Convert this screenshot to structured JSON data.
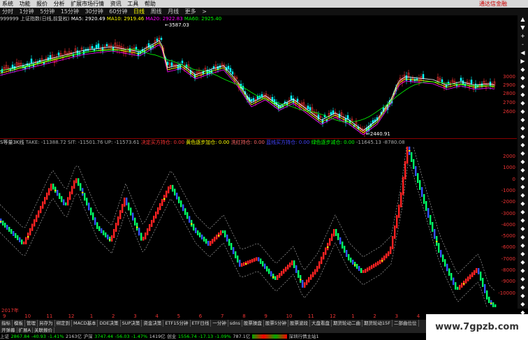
{
  "menu": {
    "items": [
      "系统",
      "功能",
      "报价",
      "分析",
      "扩展市场行情",
      "资讯",
      "工具",
      "帮助"
    ],
    "promo": "通达信金融"
  },
  "timeframes": {
    "items": [
      "分时",
      "1分钟",
      "5分钟",
      "15分钟",
      "30分钟",
      "60分钟",
      "日线",
      "周线",
      "月线",
      "更多"
    ],
    "active_index": 6,
    "arrow": ">"
  },
  "main_info": {
    "symbol": "999999 上证指数(日线,前复权)",
    "ma5": "MA5: 2920.49",
    "ma10": "MA10: 2919.46",
    "ma20": "MA20: 2922.83",
    "ma60": "MA60: 2925.40",
    "colors": {
      "ma5": "#ffffff",
      "ma10": "#ffff00",
      "ma20": "#ff00ff",
      "ma60": "#00ff00"
    }
  },
  "annotations": {
    "high": "3587.03",
    "low": "2440.91"
  },
  "main_axis": [
    "3000",
    "2900",
    "2800",
    "2700",
    "2600"
  ],
  "indicator_info": {
    "title": "S等量3K线",
    "take": "TAKE: -11388.72",
    "sit": "SIT: -11501.76",
    "up": "UP: -11573.61",
    "l1_label": "决定买方持仓: ",
    "l1_value": "0.00",
    "l2_label": "黄色逐步加仓: ",
    "l2_value": "0.00",
    "l3_label": "洗红持仓: ",
    "l3_value": "0.00",
    "l4_label": "蓝线买方持仓: ",
    "l4_value": "0.00",
    "l5_label": "绿色逐步减仓: ",
    "l5_value": "0.00",
    "v6": "-11645.13",
    "v7": "-8780.08"
  },
  "ind_axis": [
    "2000",
    "1000",
    "0",
    "-1000",
    "-2000",
    "-3000",
    "-4000",
    "-5000",
    "-6000",
    "-7000",
    "-8000",
    "-9000",
    "-10000"
  ],
  "date_axis": {
    "year_label": "2017年",
    "ticks": [
      "9",
      "10",
      "11",
      "12",
      "1",
      "2",
      "3",
      "4",
      "5",
      "6",
      "7",
      "8",
      "9",
      "10",
      "11",
      "12",
      "1",
      "2",
      "3",
      "4"
    ]
  },
  "tabs_row1": [
    "指标",
    "模板",
    "管理",
    "另存为",
    "绑定到",
    "MACD基本",
    "DDE决策",
    "SUP决策",
    "资金决策",
    "ETF15分钟",
    "ETF日线",
    "一分钟",
    "sdns",
    "股票操盘",
    "股票5分钟",
    "股票波段",
    "大盘看盘",
    "期货轮动二曲",
    "期货轮动15F",
    "二部曲位位"
  ],
  "tabs_row2": [
    "开弹幕",
    "扩展A",
    "关联报价"
  ],
  "status": {
    "sh_label": "上证",
    "sh_value": "2867.84",
    "sh_change": "-40.93",
    "sh_pct": "-1.41%",
    "sh_amount": "2163亿",
    "hs_label": "沪深",
    "hs_value": "3747.44",
    "hs_change": "-56.03",
    "hs_pct": "-1.47%",
    "hs_amount": "1419亿",
    "cy_label": "创业",
    "cy_value": "1556.74",
    "cy_change": "-17.13",
    "cy_pct": "-1.09%",
    "cy_amount": "787.1亿",
    "server": "深圳行情主站1"
  },
  "scroll_buttons": [
    "▲",
    "▼",
    "+",
    "-",
    "◀",
    "▶",
    "◆",
    "◆",
    "◆",
    "◆",
    "◆",
    "◆",
    "◆",
    "◆",
    "◆",
    "◆",
    "◆",
    "◆",
    "◆",
    "◆",
    "◆",
    "◆",
    "◆",
    "◆",
    "◆",
    "◆",
    "◆",
    "◆",
    "◆",
    "◆",
    "◆",
    "◆",
    "◆",
    "◆",
    "◆",
    "◆"
  ],
  "watermark": "www.7gpzb.com"
}
